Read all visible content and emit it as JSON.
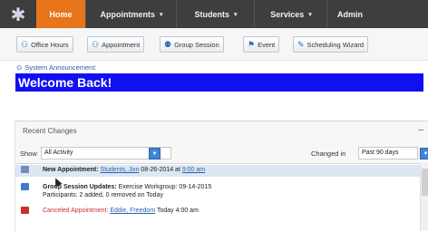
{
  "nav": {
    "tabs": [
      {
        "label": "Home",
        "has_caret": false,
        "active": true
      },
      {
        "label": "Appointments",
        "has_caret": true
      },
      {
        "label": "Students",
        "has_caret": true
      },
      {
        "label": "Services",
        "has_caret": true
      },
      {
        "label": "Admin",
        "has_caret": false
      }
    ],
    "accent_color": "#e8751a",
    "bar_color": "#3e3e3e"
  },
  "toolbar": {
    "buttons": [
      {
        "label": "Office Hours",
        "icon": "office-hours-icon"
      },
      {
        "label": "Appointment",
        "icon": "appointment-icon"
      },
      {
        "label": "Group Session",
        "icon": "group-session-icon"
      },
      {
        "label": "Event",
        "icon": "event-icon"
      },
      {
        "label": "Scheduling Wizard",
        "icon": "wizard-icon"
      }
    ]
  },
  "announcement": {
    "label": "System Announcement:",
    "message": "Welcome Back!",
    "banner_color": "#1010f2"
  },
  "recent_changes": {
    "title": "Recent Changes",
    "show_label": "Show",
    "show_value": "All Activity",
    "changed_in_label": "Changed in",
    "changed_in_value": "Past 90 days",
    "items": [
      {
        "title": "New Appointment:",
        "student": "Students, Jon",
        "date": "08-26-2014 at",
        "time": "9:00 am"
      },
      {
        "title": "Group Session Updates:",
        "detail": "Exercise Workgroup: 09-14-2015",
        "participants": "Participants: 2 added, 0 removed on Today"
      },
      {
        "title": "Canceled Appointment:",
        "student": "Eddie, Freedom",
        "date": "Today 4:00 am"
      }
    ]
  }
}
